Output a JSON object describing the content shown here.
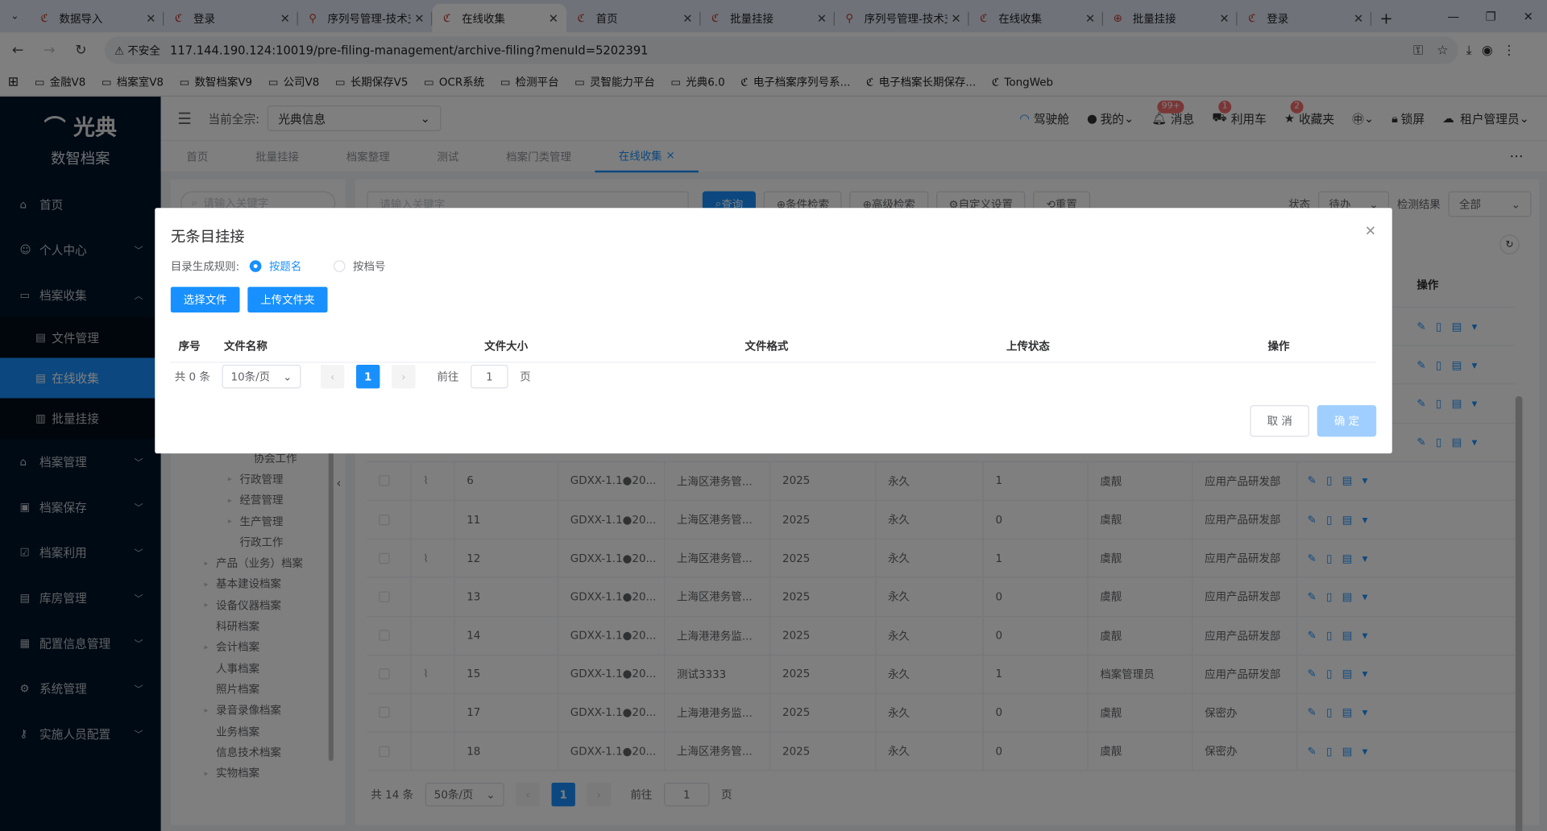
{
  "browser": {
    "tabs": [
      {
        "title": "数据导入",
        "active": false
      },
      {
        "title": "登录",
        "active": false
      },
      {
        "title": "序列号管理-技术支",
        "active": false
      },
      {
        "title": "在线收集",
        "active": true
      },
      {
        "title": "首页",
        "active": false
      },
      {
        "title": "批量挂接",
        "active": false
      },
      {
        "title": "序列号管理-技术支",
        "active": false
      },
      {
        "title": "在线收集",
        "active": false
      },
      {
        "title": "批量挂接",
        "active": false
      },
      {
        "title": "登录",
        "active": false
      }
    ],
    "insecure_label": "不安全",
    "url": "117.144.190.124:10019/pre-filing-management/archive-filing?menuId=5202391",
    "bookmarks": [
      "金融V8",
      "档案室V8",
      "数智档案V9",
      "公司V8",
      "长期保存V5",
      "OCR系统",
      "检测平台",
      "灵智能力平台",
      "光典6.0",
      "电子档案序列号系...",
      "电子档案长期保存...",
      "TongWeb"
    ]
  },
  "sidebar": {
    "brand": "光典",
    "subtitle": "数智档案",
    "items": [
      {
        "label": "首页",
        "icon": "home-icon",
        "glyph": "⌂"
      },
      {
        "label": "个人中心",
        "icon": "user-icon",
        "glyph": "☺",
        "chevron": true
      },
      {
        "label": "档案收集",
        "icon": "folder-icon",
        "glyph": "▭",
        "chevron": true,
        "open": true
      },
      {
        "label": "档案管理",
        "icon": "bank-icon",
        "glyph": "⌂",
        "chevron": true
      },
      {
        "label": "档案保存",
        "icon": "box-icon",
        "glyph": "▣",
        "chevron": true
      },
      {
        "label": "档案利用",
        "icon": "check-icon",
        "glyph": "☑",
        "chevron": true
      },
      {
        "label": "库房管理",
        "icon": "warehouse-icon",
        "glyph": "▤",
        "chevron": true
      },
      {
        "label": "配置信息管理",
        "icon": "config-icon",
        "glyph": "▦",
        "chevron": true
      },
      {
        "label": "系统管理",
        "icon": "gear-icon",
        "glyph": "⚙",
        "chevron": true
      },
      {
        "label": "实施人员配置",
        "icon": "key-icon",
        "glyph": "⚷",
        "chevron": true
      }
    ],
    "subitems": [
      {
        "label": "文件管理",
        "active": false
      },
      {
        "label": "在线收集",
        "active": true
      },
      {
        "label": "批量挂接",
        "active": false
      }
    ]
  },
  "topbar": {
    "current_org_label": "当前全宗:",
    "current_org": "光典信息",
    "cockpit": "驾驶舱",
    "mine": "我的",
    "messages": "消息",
    "messages_badge": "99+",
    "cart": "利用车",
    "cart_badge": "1",
    "favorites": "收藏夹",
    "favorites_badge": "2",
    "lock": "锁屏",
    "tenant": "租户管理员"
  },
  "navtabs": [
    "首页",
    "批量挂接",
    "档案整理",
    "测试",
    "档案门类管理",
    "在线收集"
  ],
  "leftpanel": {
    "search_placeholder": "请输入关键字",
    "tree": [
      {
        "label": "协会工作",
        "indent": 72,
        "arrow": false
      },
      {
        "label": "行政管理",
        "indent": 58,
        "arrow": true
      },
      {
        "label": "经营管理",
        "indent": 58,
        "arrow": true
      },
      {
        "label": "生产管理",
        "indent": 58,
        "arrow": true
      },
      {
        "label": "行政工作",
        "indent": 58,
        "arrow": false
      },
      {
        "label": "产品（业务）档案",
        "indent": 34,
        "arrow": true
      },
      {
        "label": "基本建设档案",
        "indent": 34,
        "arrow": true
      },
      {
        "label": "设备仪器档案",
        "indent": 34,
        "arrow": true
      },
      {
        "label": "科研档案",
        "indent": 34,
        "arrow": false
      },
      {
        "label": "会计档案",
        "indent": 34,
        "arrow": true
      },
      {
        "label": "人事档案",
        "indent": 34,
        "arrow": false
      },
      {
        "label": "照片档案",
        "indent": 34,
        "arrow": false
      },
      {
        "label": "录音录像档案",
        "indent": 34,
        "arrow": true
      },
      {
        "label": "业务档案",
        "indent": 34,
        "arrow": false
      },
      {
        "label": "信息技术档案",
        "indent": 34,
        "arrow": false
      },
      {
        "label": "实物档案",
        "indent": 34,
        "arrow": true
      }
    ]
  },
  "toolbar": {
    "search_placeholder": "请输入关键字",
    "query": "查询",
    "condition_search": "条件检索",
    "advanced_search": "高级检索",
    "custom_settings": "自定义设置",
    "reset": "重置",
    "status_label": "状态",
    "status_value": "待办",
    "result_label": "检测结果",
    "result_value": "全部"
  },
  "grid": {
    "ops_header": "操作",
    "rows": [
      {
        "attach": true,
        "seq": "6",
        "code": "GDXX-1.1●20...",
        "title": "上海区港务管...",
        "year": "2025",
        "retention": "永久",
        "count": "1",
        "person": "虞靓",
        "dept": "应用产品研发部"
      },
      {
        "attach": false,
        "seq": "11",
        "code": "GDXX-1.1●20...",
        "title": "上海区港务管...",
        "year": "2025",
        "retention": "永久",
        "count": "0",
        "person": "虞靓",
        "dept": "应用产品研发部"
      },
      {
        "attach": true,
        "seq": "12",
        "code": "GDXX-1.1●20...",
        "title": "上海区港务管...",
        "year": "2025",
        "retention": "永久",
        "count": "1",
        "person": "虞靓",
        "dept": "应用产品研发部"
      },
      {
        "attach": false,
        "seq": "13",
        "code": "GDXX-1.1●20...",
        "title": "上海区港务管...",
        "year": "2025",
        "retention": "永久",
        "count": "0",
        "person": "虞靓",
        "dept": "应用产品研发部"
      },
      {
        "attach": false,
        "seq": "14",
        "code": "GDXX-1.1●20...",
        "title": "上海港港务监...",
        "year": "2025",
        "retention": "永久",
        "count": "0",
        "person": "虞靓",
        "dept": "应用产品研发部"
      },
      {
        "attach": true,
        "seq": "15",
        "code": "GDXX-1.1●20...",
        "title": "测试3333",
        "year": "2025",
        "retention": "永久",
        "count": "1",
        "person": "档案管理员",
        "dept": "应用产品研发部"
      },
      {
        "attach": false,
        "seq": "17",
        "code": "GDXX-1.1●20...",
        "title": "上海港港务监...",
        "year": "2025",
        "retention": "永久",
        "count": "0",
        "person": "虞靓",
        "dept": "保密办"
      },
      {
        "attach": false,
        "seq": "18",
        "code": "GDXX-1.1●20...",
        "title": "上海区港务管...",
        "year": "2025",
        "retention": "永久",
        "count": "0",
        "person": "虞靓",
        "dept": "保密办"
      }
    ]
  },
  "pager": {
    "total": "共 14 条",
    "page_size": "50条/页",
    "current": "1",
    "goto_label": "前往",
    "goto_value": "1",
    "page_unit": "页"
  },
  "dialog": {
    "title": "无条目挂接",
    "rule_label": "目录生成规则:",
    "rule_options": [
      {
        "label": "按题名",
        "selected": true
      },
      {
        "label": "按档号",
        "selected": false
      }
    ],
    "select_files": "选择文件",
    "upload_folder": "上传文件夹",
    "columns": [
      "序号",
      "文件名称",
      "文件大小",
      "文件格式",
      "上传状态",
      "操作"
    ],
    "pager": {
      "total": "共 0 条",
      "page_size": "10条/页",
      "current": "1",
      "goto_label": "前往",
      "goto_value": "1",
      "page_unit": "页"
    },
    "cancel": "取 消",
    "confirm": "确 定"
  }
}
